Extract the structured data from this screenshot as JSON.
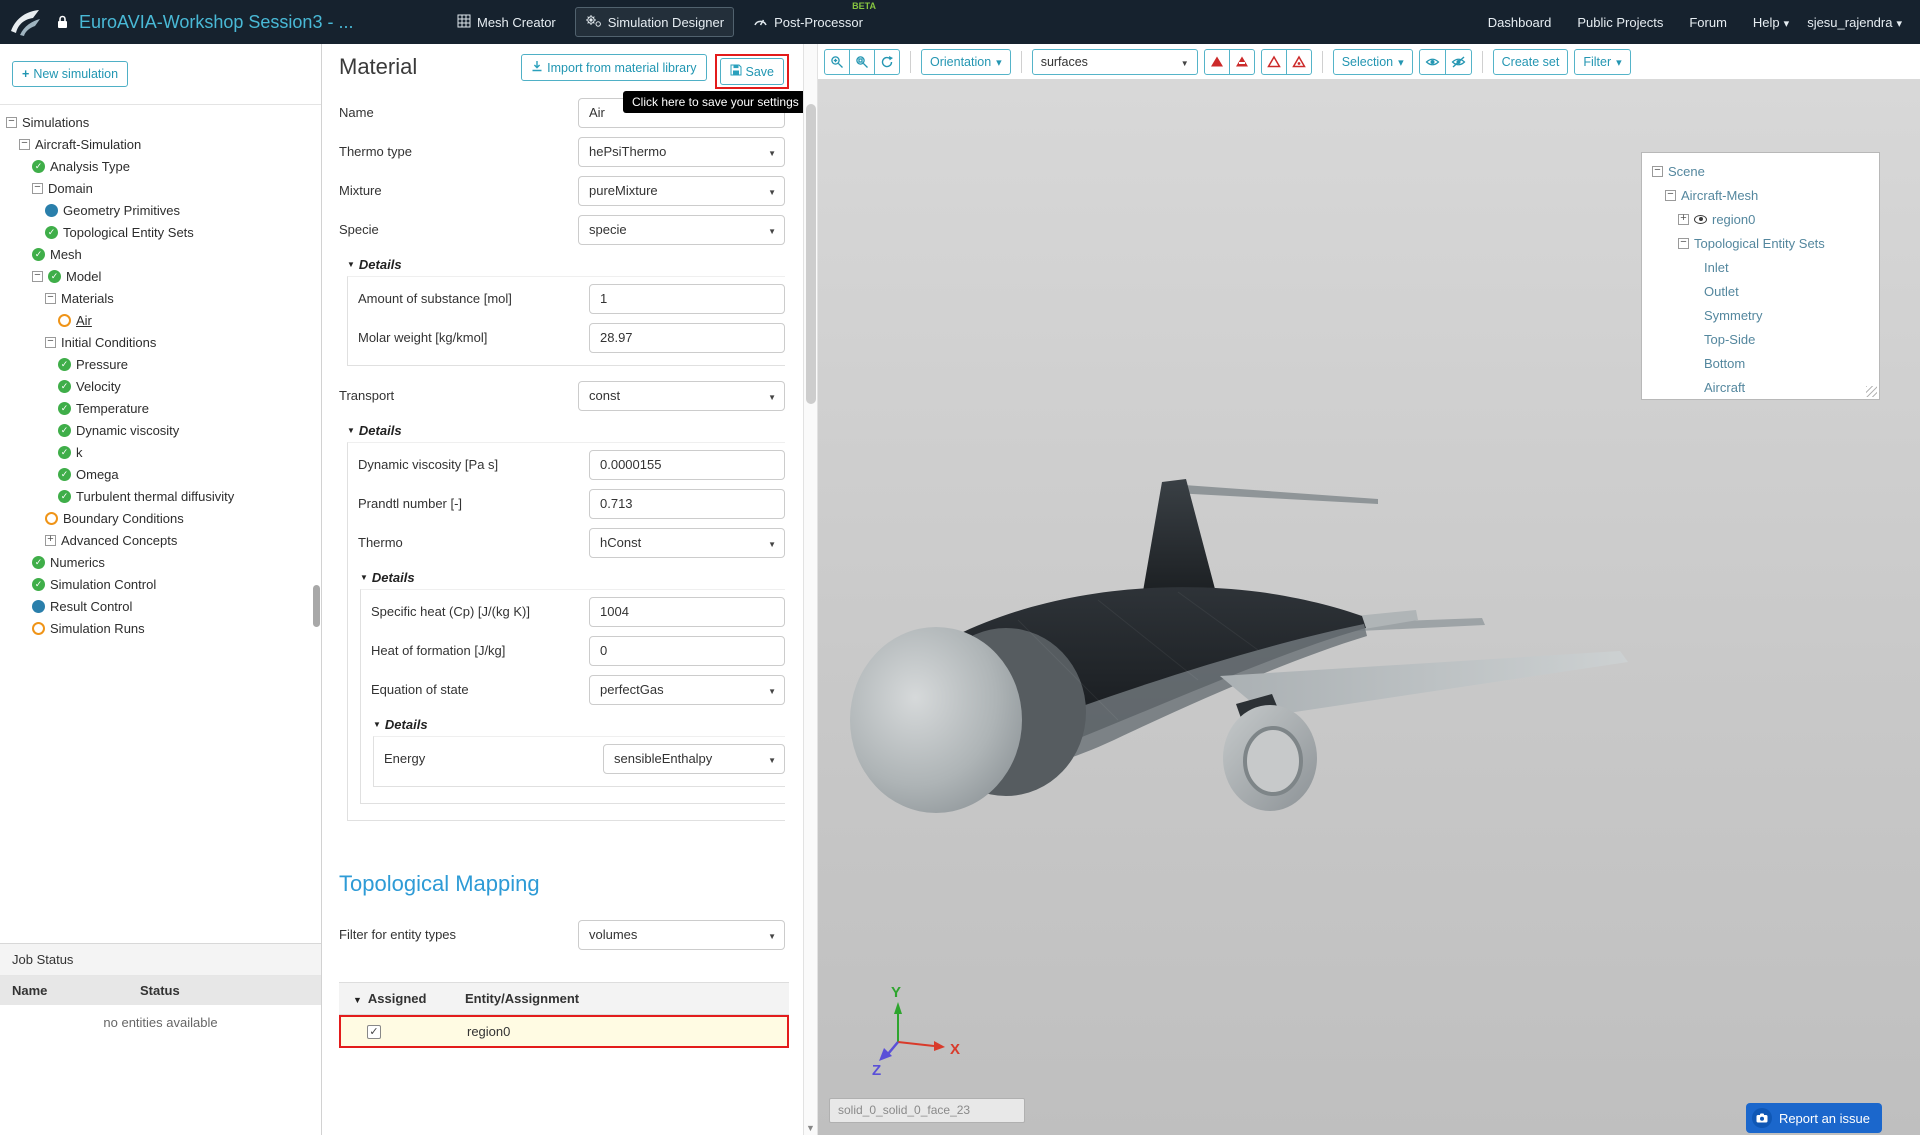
{
  "colors": {
    "navbar_bg": "#16222e",
    "accent_teal": "#2aa0bc",
    "title_teal": "#49b9d6",
    "annotation_red": "#e31b1b",
    "beta_green": "#86c440",
    "status_green": "#3fae49",
    "status_orange": "#ef9418",
    "status_blue": "#2a7fab",
    "report_blue": "#1b67cc",
    "topo_heading_blue": "#2e9bd6"
  },
  "icons": {
    "new_simulation": "plus",
    "import": "download-arrow",
    "save": "floppy-disk",
    "zoom_in": "magnifier-plus",
    "zoom_window": "magnifier-box",
    "refresh": "circular-arrows",
    "show": "eye",
    "hide": "eye-slash",
    "report": "camera",
    "lock": "padlock",
    "mesh_creator": "grid-cube",
    "simulation_designer": "gears",
    "post_processor": "gauge"
  },
  "navbar": {
    "project_title": "EuroAVIA-Workshop Session3 - ...",
    "tabs": [
      {
        "label": "Mesh Creator"
      },
      {
        "label": "Simulation Designer"
      },
      {
        "label": "Post-Processor",
        "badge": "BETA"
      }
    ],
    "links": [
      {
        "label": "Dashboard"
      },
      {
        "label": "Public Projects"
      },
      {
        "label": "Forum"
      },
      {
        "label": "Help",
        "caret": "on"
      }
    ],
    "user": {
      "label": "sjesu_rajendra"
    }
  },
  "sidebar": {
    "new_simulation": "New simulation",
    "tree": [
      {
        "level": 0,
        "expand": "minus",
        "label": "Simulations"
      },
      {
        "level": 1,
        "expand": "minus",
        "label": "Aircraft-Simulation"
      },
      {
        "level": 2,
        "status": "check",
        "label": "Analysis Type"
      },
      {
        "level": 2,
        "expand": "minus",
        "label": "Domain"
      },
      {
        "level": 3,
        "status": "blue",
        "label": "Geometry Primitives"
      },
      {
        "level": 3,
        "status": "check",
        "label": "Topological Entity Sets"
      },
      {
        "level": 2,
        "status": "check",
        "label": "Mesh"
      },
      {
        "level": 2,
        "expand": "minus",
        "status": "check",
        "label": "Model"
      },
      {
        "level": 3,
        "expand": "minus",
        "label": "Materials"
      },
      {
        "level": 4,
        "status": "orange",
        "selected": "selected",
        "label": "Air"
      },
      {
        "level": 3,
        "expand": "minus",
        "label": "Initial Conditions"
      },
      {
        "level": 4,
        "status": "check",
        "label": "Pressure"
      },
      {
        "level": 4,
        "status": "check",
        "label": "Velocity"
      },
      {
        "level": 4,
        "status": "check",
        "label": "Temperature"
      },
      {
        "level": 4,
        "status": "check",
        "label": "Dynamic viscosity"
      },
      {
        "level": 4,
        "status": "check",
        "label": "k"
      },
      {
        "level": 4,
        "status": "check",
        "label": "Omega"
      },
      {
        "level": 4,
        "status": "check",
        "label": "Turbulent thermal diffusivity"
      },
      {
        "level": 3,
        "status": "orange",
        "label": "Boundary Conditions"
      },
      {
        "level": 3,
        "expand": "plus",
        "label": "Advanced Concepts"
      },
      {
        "level": 2,
        "status": "check",
        "label": "Numerics"
      },
      {
        "level": 2,
        "status": "check",
        "label": "Simulation Control"
      },
      {
        "level": 2,
        "status": "blue",
        "label": "Result Control"
      },
      {
        "level": 2,
        "status": "orange",
        "label": "Simulation Runs"
      }
    ],
    "job_status": {
      "title": "Job Status",
      "columns": [
        "Name",
        "Status"
      ],
      "empty": "no entities available"
    }
  },
  "material": {
    "title": "Material",
    "import_button": "Import from material library",
    "save_button": "Save",
    "save_tooltip": "Click here to save your settings",
    "details_label": "Details",
    "fields": {
      "name": {
        "label": "Name",
        "value": "Air"
      },
      "thermo_type": {
        "label": "Thermo type",
        "value": "hePsiThermo"
      },
      "mixture": {
        "label": "Mixture",
        "value": "pureMixture"
      },
      "specie": {
        "label": "Specie",
        "value": "specie"
      },
      "amount_of_substance": {
        "label": "Amount of substance [mol]",
        "value": "1"
      },
      "molar_weight": {
        "label": "Molar weight [kg/kmol]",
        "value": "28.97"
      },
      "transport": {
        "label": "Transport",
        "value": "const"
      },
      "dynamic_viscosity": {
        "label": "Dynamic viscosity [Pa s]",
        "value": "0.0000155"
      },
      "prandtl_number": {
        "label": "Prandtl number [-]",
        "value": "0.713"
      },
      "thermo": {
        "label": "Thermo",
        "value": "hConst"
      },
      "specific_heat": {
        "label": "Specific heat (Cp) [J/(kg K)]",
        "value": "1004"
      },
      "heat_of_formation": {
        "label": "Heat of formation [J/kg]",
        "value": "0"
      },
      "equation_of_state": {
        "label": "Equation of state",
        "value": "perfectGas"
      },
      "energy": {
        "label": "Energy",
        "value": "sensibleEnthalpy"
      }
    },
    "topological_mapping": {
      "title": "Topological Mapping",
      "filter_label": "Filter for entity types",
      "filter_value": "volumes",
      "table": {
        "col_assigned": "Assigned",
        "col_entity": "Entity/Assignment",
        "rows": [
          {
            "entity": "region0",
            "checked": true
          }
        ]
      }
    }
  },
  "viewport": {
    "toolbar": {
      "orientation": "Orientation",
      "display_mode": "surfaces",
      "selection": "Selection",
      "create_set": "Create set",
      "filter": "Filter"
    },
    "scene_tree": [
      {
        "level": 0,
        "expand": "minus",
        "label": "Scene"
      },
      {
        "level": 1,
        "expand": "minus",
        "label": "Aircraft-Mesh"
      },
      {
        "level": 2,
        "expand": "plus",
        "eye": "on",
        "label": "region0"
      },
      {
        "level": 2,
        "expand": "minus",
        "label": "Topological Entity Sets"
      },
      {
        "level": 4,
        "label": "Inlet"
      },
      {
        "level": 4,
        "label": "Outlet"
      },
      {
        "level": 4,
        "label": "Symmetry"
      },
      {
        "level": 4,
        "label": "Top-Side"
      },
      {
        "level": 4,
        "label": "Bottom"
      },
      {
        "level": 4,
        "label": "Aircraft"
      }
    ],
    "axis": {
      "x": "X",
      "y": "Y",
      "z": "Z"
    },
    "face_label": "solid_0_solid_0_face_23",
    "report_button": "Report an issue"
  }
}
